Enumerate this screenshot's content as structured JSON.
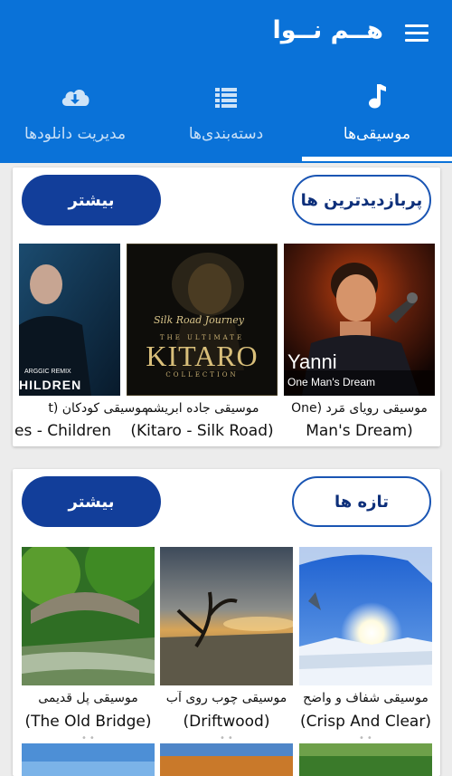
{
  "appbar": {
    "title": "هــم نــوا",
    "menu_icon": "hamburger-menu-icon",
    "color": "#0a72d8"
  },
  "tabs": [
    {
      "label": "موسیقی‌ها",
      "icon": "music-note-icon",
      "active": true
    },
    {
      "label": "دسته‌بندی‌ها",
      "icon": "list-view-icon",
      "active": false
    },
    {
      "label": "مدیریت دانلودها",
      "icon": "cloud-download-icon",
      "active": false
    }
  ],
  "sections": [
    {
      "title": "پربازدیدترین ها",
      "more_label": "بیشتر",
      "items": [
        {
          "title": "موسیقی رویای مَرد (One",
          "subtitle": "Man's Dream)",
          "overlay_title": "Yanni",
          "overlay_sub": "One Man's Dream"
        },
        {
          "title": "موسیقی جاده ابریشم",
          "subtitle": "(Kitaro - Silk Road)",
          "overlay_top": "Silk Road Journey",
          "overlay_mid": "THE ULTIMATE",
          "overlay_main": "KITARO",
          "overlay_bottom": "COLLECTION"
        },
        {
          "title": "موسیقی کودکان (t",
          "subtitle": "es - Children",
          "overlay_sub": "ARGGIC REMIX",
          "overlay_main": "HILDREN"
        }
      ]
    },
    {
      "title": "تازه ها",
      "more_label": "بیشتر",
      "items": [
        {
          "title": "موسیقی شفاف و واضح",
          "subtitle": "(Crisp And Clear)"
        },
        {
          "title": "موسیقی چوب روی آب",
          "subtitle": "(Driftwood)"
        },
        {
          "title": "موسیقی پل قدیمی",
          "subtitle": "(The Old Bridge)"
        }
      ]
    }
  ]
}
